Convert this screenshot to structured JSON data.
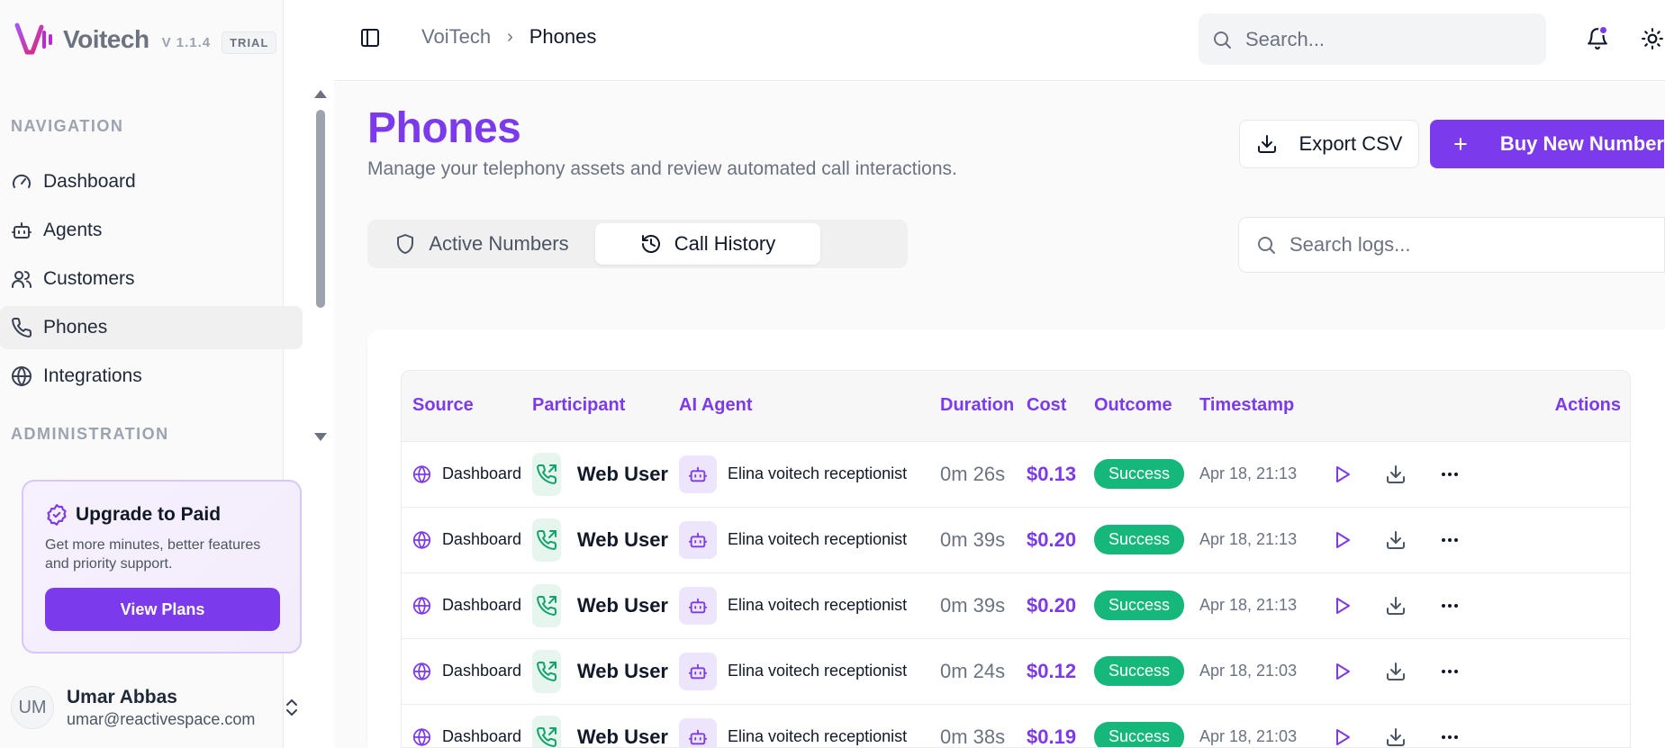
{
  "app": {
    "name": "Voitech",
    "version": "V 1.1.4",
    "badge": "TRIAL"
  },
  "sidebar": {
    "navigation_label": "NAVIGATION",
    "administration_label": "ADMINISTRATION",
    "items": [
      {
        "label": "Dashboard",
        "icon": "gauge-icon"
      },
      {
        "label": "Agents",
        "icon": "bot-icon"
      },
      {
        "label": "Customers",
        "icon": "users-icon"
      },
      {
        "label": "Phones",
        "icon": "phone-icon",
        "active": true
      },
      {
        "label": "Integrations",
        "icon": "globe-icon"
      }
    ],
    "upgrade": {
      "title": "Upgrade to Paid",
      "description": "Get more minutes, better features and priority support.",
      "button": "View Plans"
    },
    "user": {
      "initials": "UM",
      "name": "Umar Abbas",
      "email": "umar@reactivespace.com"
    }
  },
  "header": {
    "breadcrumb_root": "VoiTech",
    "breadcrumb_current": "Phones",
    "search_placeholder": "Search..."
  },
  "page": {
    "title": "Phones",
    "subtitle": "Manage your telephony assets and review automated call interactions.",
    "export_label": "Export CSV",
    "buy_label": "Buy New Number",
    "tabs": [
      {
        "label": "Active Numbers",
        "active": false
      },
      {
        "label": "Call History",
        "active": true
      }
    ],
    "log_search_placeholder": "Search logs..."
  },
  "table": {
    "columns": [
      "Source",
      "Participant",
      "AI Agent",
      "Duration",
      "Cost",
      "Outcome",
      "Timestamp",
      "Actions"
    ],
    "rows": [
      {
        "source": "Dashboard",
        "participant": "Web User",
        "agent": "Elina voitech receptionist",
        "duration": "0m 26s",
        "cost": "$0.13",
        "outcome": "Success",
        "timestamp": "Apr 18, 21:13"
      },
      {
        "source": "Dashboard",
        "participant": "Web User",
        "agent": "Elina voitech receptionist",
        "duration": "0m 39s",
        "cost": "$0.20",
        "outcome": "Success",
        "timestamp": "Apr 18, 21:13"
      },
      {
        "source": "Dashboard",
        "participant": "Web User",
        "agent": "Elina voitech receptionist",
        "duration": "0m 39s",
        "cost": "$0.20",
        "outcome": "Success",
        "timestamp": "Apr 18, 21:13"
      },
      {
        "source": "Dashboard",
        "participant": "Web User",
        "agent": "Elina voitech receptionist",
        "duration": "0m 24s",
        "cost": "$0.12",
        "outcome": "Success",
        "timestamp": "Apr 18, 21:03"
      },
      {
        "source": "Dashboard",
        "participant": "Web User",
        "agent": "Elina voitech receptionist",
        "duration": "0m 38s",
        "cost": "$0.19",
        "outcome": "Success",
        "timestamp": "Apr 18, 21:03"
      }
    ]
  },
  "colors": {
    "brand": "#7c3aed",
    "success": "#16b77a",
    "participant_icon": "#10a36b"
  }
}
